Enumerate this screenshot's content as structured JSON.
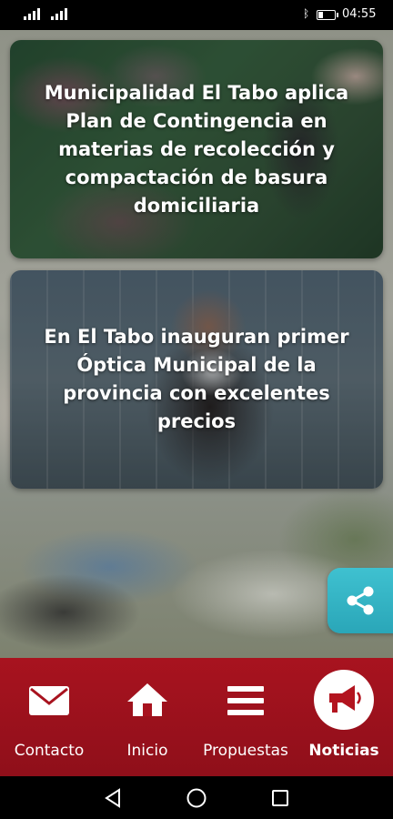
{
  "status_bar": {
    "signal_1": "4G",
    "signal_2": "4G",
    "battery_percent": 30,
    "time": "04:55"
  },
  "news": [
    {
      "title": "Municipalidad El Tabo aplica Plan de Contingencia en materias de recolección y compactación de basura domiciliaria"
    },
    {
      "title": "En El Tabo inauguran primer Óptica Municipal de la provincia con excelentes precios"
    }
  ],
  "share_icon": "share-icon",
  "bottom_nav": {
    "items": [
      {
        "label": "Contacto",
        "icon": "envelope-icon",
        "active": false
      },
      {
        "label": "Inicio",
        "icon": "home-icon",
        "active": false
      },
      {
        "label": "Propuestas",
        "icon": "menu-icon",
        "active": false
      },
      {
        "label": "Noticias",
        "icon": "megaphone-icon",
        "active": true
      }
    ]
  },
  "colors": {
    "nav_background": "#a8131f",
    "share_accent": "#3fc1d0",
    "megaphone": "#b3141f"
  }
}
